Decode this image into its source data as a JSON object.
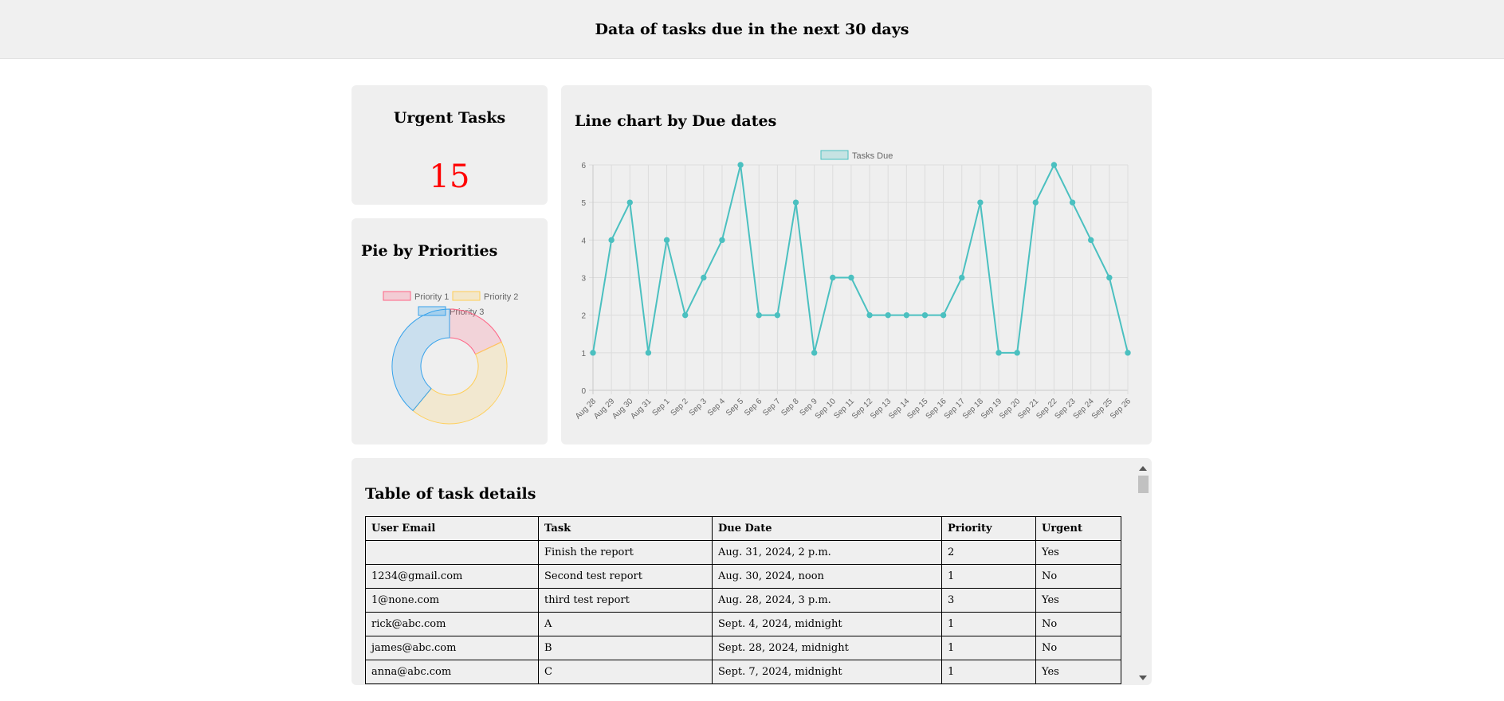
{
  "header": {
    "title": "Data of tasks due in the next 30 days"
  },
  "urgent": {
    "title": "Urgent Tasks",
    "count": "15"
  },
  "pie": {
    "title": "Pie by Priorities",
    "legend": [
      "Priority 1",
      "Priority 2",
      "Priority 3"
    ]
  },
  "line": {
    "title": "Line chart by Due dates"
  },
  "chart_data": [
    {
      "type": "pie",
      "donut": true,
      "categories": [
        "Priority 1",
        "Priority 2",
        "Priority 3"
      ],
      "values": [
        18,
        43,
        39
      ],
      "colors": [
        "#ff6384",
        "#ffce56",
        "#36a2eb"
      ]
    },
    {
      "type": "line",
      "categories": [
        "Aug 28",
        "Aug 29",
        "Aug 30",
        "Aug 31",
        "Sep 1",
        "Sep 2",
        "Sep 3",
        "Sep 4",
        "Sep 5",
        "Sep 6",
        "Sep 7",
        "Sep 8",
        "Sep 9",
        "Sep 10",
        "Sep 11",
        "Sep 12",
        "Sep 13",
        "Sep 14",
        "Sep 15",
        "Sep 16",
        "Sep 17",
        "Sep 18",
        "Sep 19",
        "Sep 20",
        "Sep 21",
        "Sep 22",
        "Sep 23",
        "Sep 24",
        "Sep 25",
        "Sep 26"
      ],
      "series": [
        {
          "name": "Tasks Due",
          "values": [
            1,
            4,
            5,
            1,
            4,
            2,
            3,
            4,
            6,
            2,
            2,
            5,
            1,
            3,
            3,
            2,
            2,
            2,
            2,
            2,
            3,
            5,
            1,
            1,
            5,
            6,
            5,
            4,
            3,
            1
          ]
        }
      ],
      "ylim": [
        0,
        6
      ],
      "yticks": [
        "0",
        "1",
        "2",
        "3",
        "4",
        "5",
        "6"
      ],
      "grid": true,
      "legend_position": "top",
      "color": "#4bc0c0"
    }
  ],
  "table": {
    "title": "Table of task details",
    "columns": [
      "User Email",
      "Task",
      "Due Date",
      "Priority",
      "Urgent"
    ],
    "rows": [
      [
        "",
        "Finish the report",
        "Aug. 31, 2024, 2 p.m.",
        "2",
        "Yes"
      ],
      [
        "1234@gmail.com",
        "Second test report",
        "Aug. 30, 2024, noon",
        "1",
        "No"
      ],
      [
        "1@none.com",
        "third test report",
        "Aug. 28, 2024, 3 p.m.",
        "3",
        "Yes"
      ],
      [
        "rick@abc.com",
        "A",
        "Sept. 4, 2024, midnight",
        "1",
        "No"
      ],
      [
        "james@abc.com",
        "B",
        "Sept. 28, 2024, midnight",
        "1",
        "No"
      ],
      [
        "anna@abc.com",
        "C",
        "Sept. 7, 2024, midnight",
        "1",
        "Yes"
      ]
    ]
  }
}
